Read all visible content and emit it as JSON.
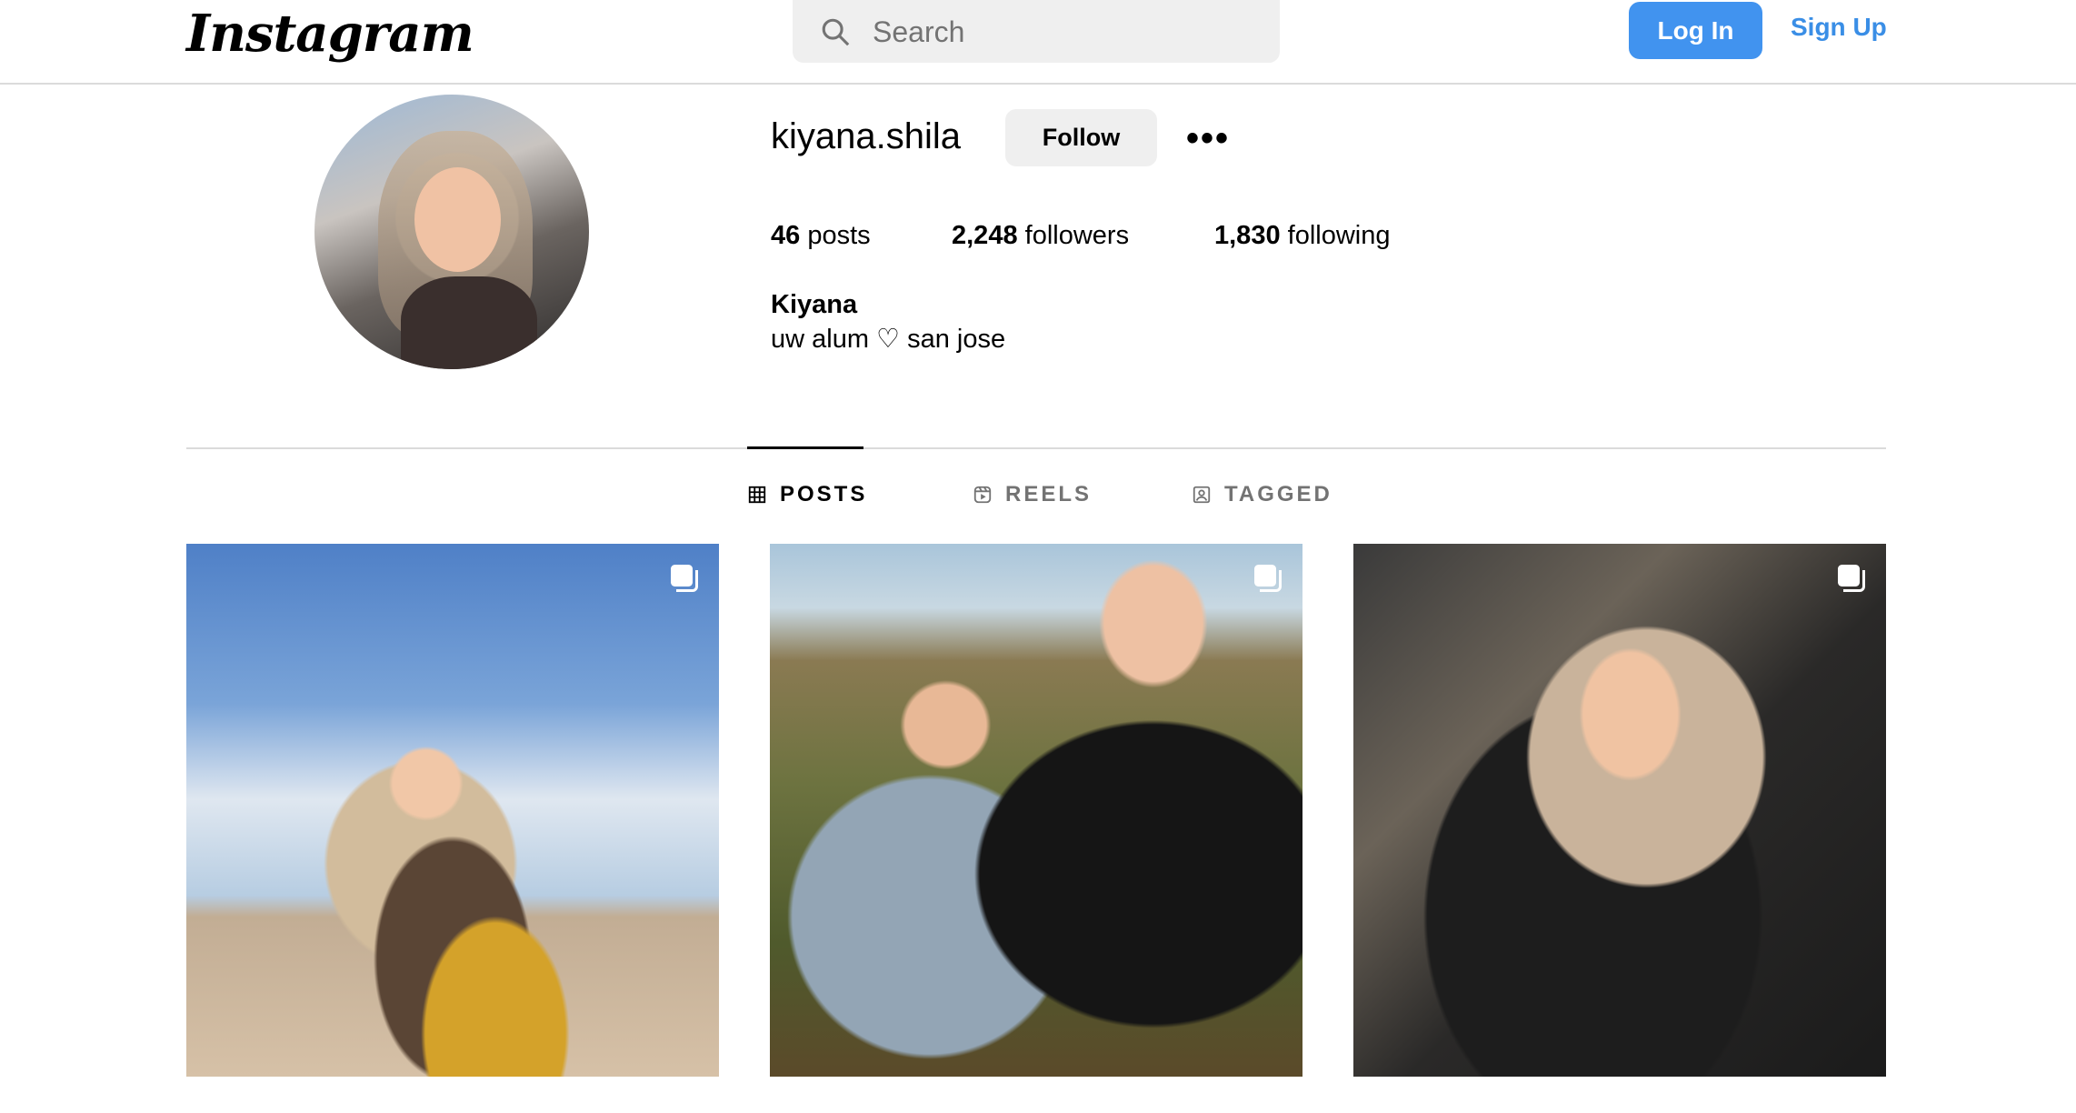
{
  "header": {
    "logo": "Instagram",
    "search_placeholder": "Search",
    "login_label": "Log In",
    "signup_label": "Sign Up"
  },
  "profile": {
    "username": "kiyana.shila",
    "follow_label": "Follow",
    "more_label": "•••",
    "stats": {
      "posts_count": "46",
      "posts_label": "posts",
      "followers_count": "2,248",
      "followers_label": "followers",
      "following_count": "1,830",
      "following_label": "following"
    },
    "full_name": "Kiyana",
    "bio": "uw alum ♡ san jose"
  },
  "tabs": [
    {
      "label": "POSTS",
      "icon": "grid-icon",
      "active": true
    },
    {
      "label": "REELS",
      "icon": "reels-icon",
      "active": false
    },
    {
      "label": "TAGGED",
      "icon": "tagged-icon",
      "active": false
    }
  ],
  "posts": [
    {
      "icon": "multiple-photos-icon"
    },
    {
      "icon": "multiple-photos-icon"
    },
    {
      "icon": "multiple-photos-icon"
    }
  ],
  "colors": {
    "accent_blue": "#4193ef",
    "link_blue": "#3a8ee6",
    "divider": "#dbdbdb",
    "button_gray": "#efefef"
  }
}
